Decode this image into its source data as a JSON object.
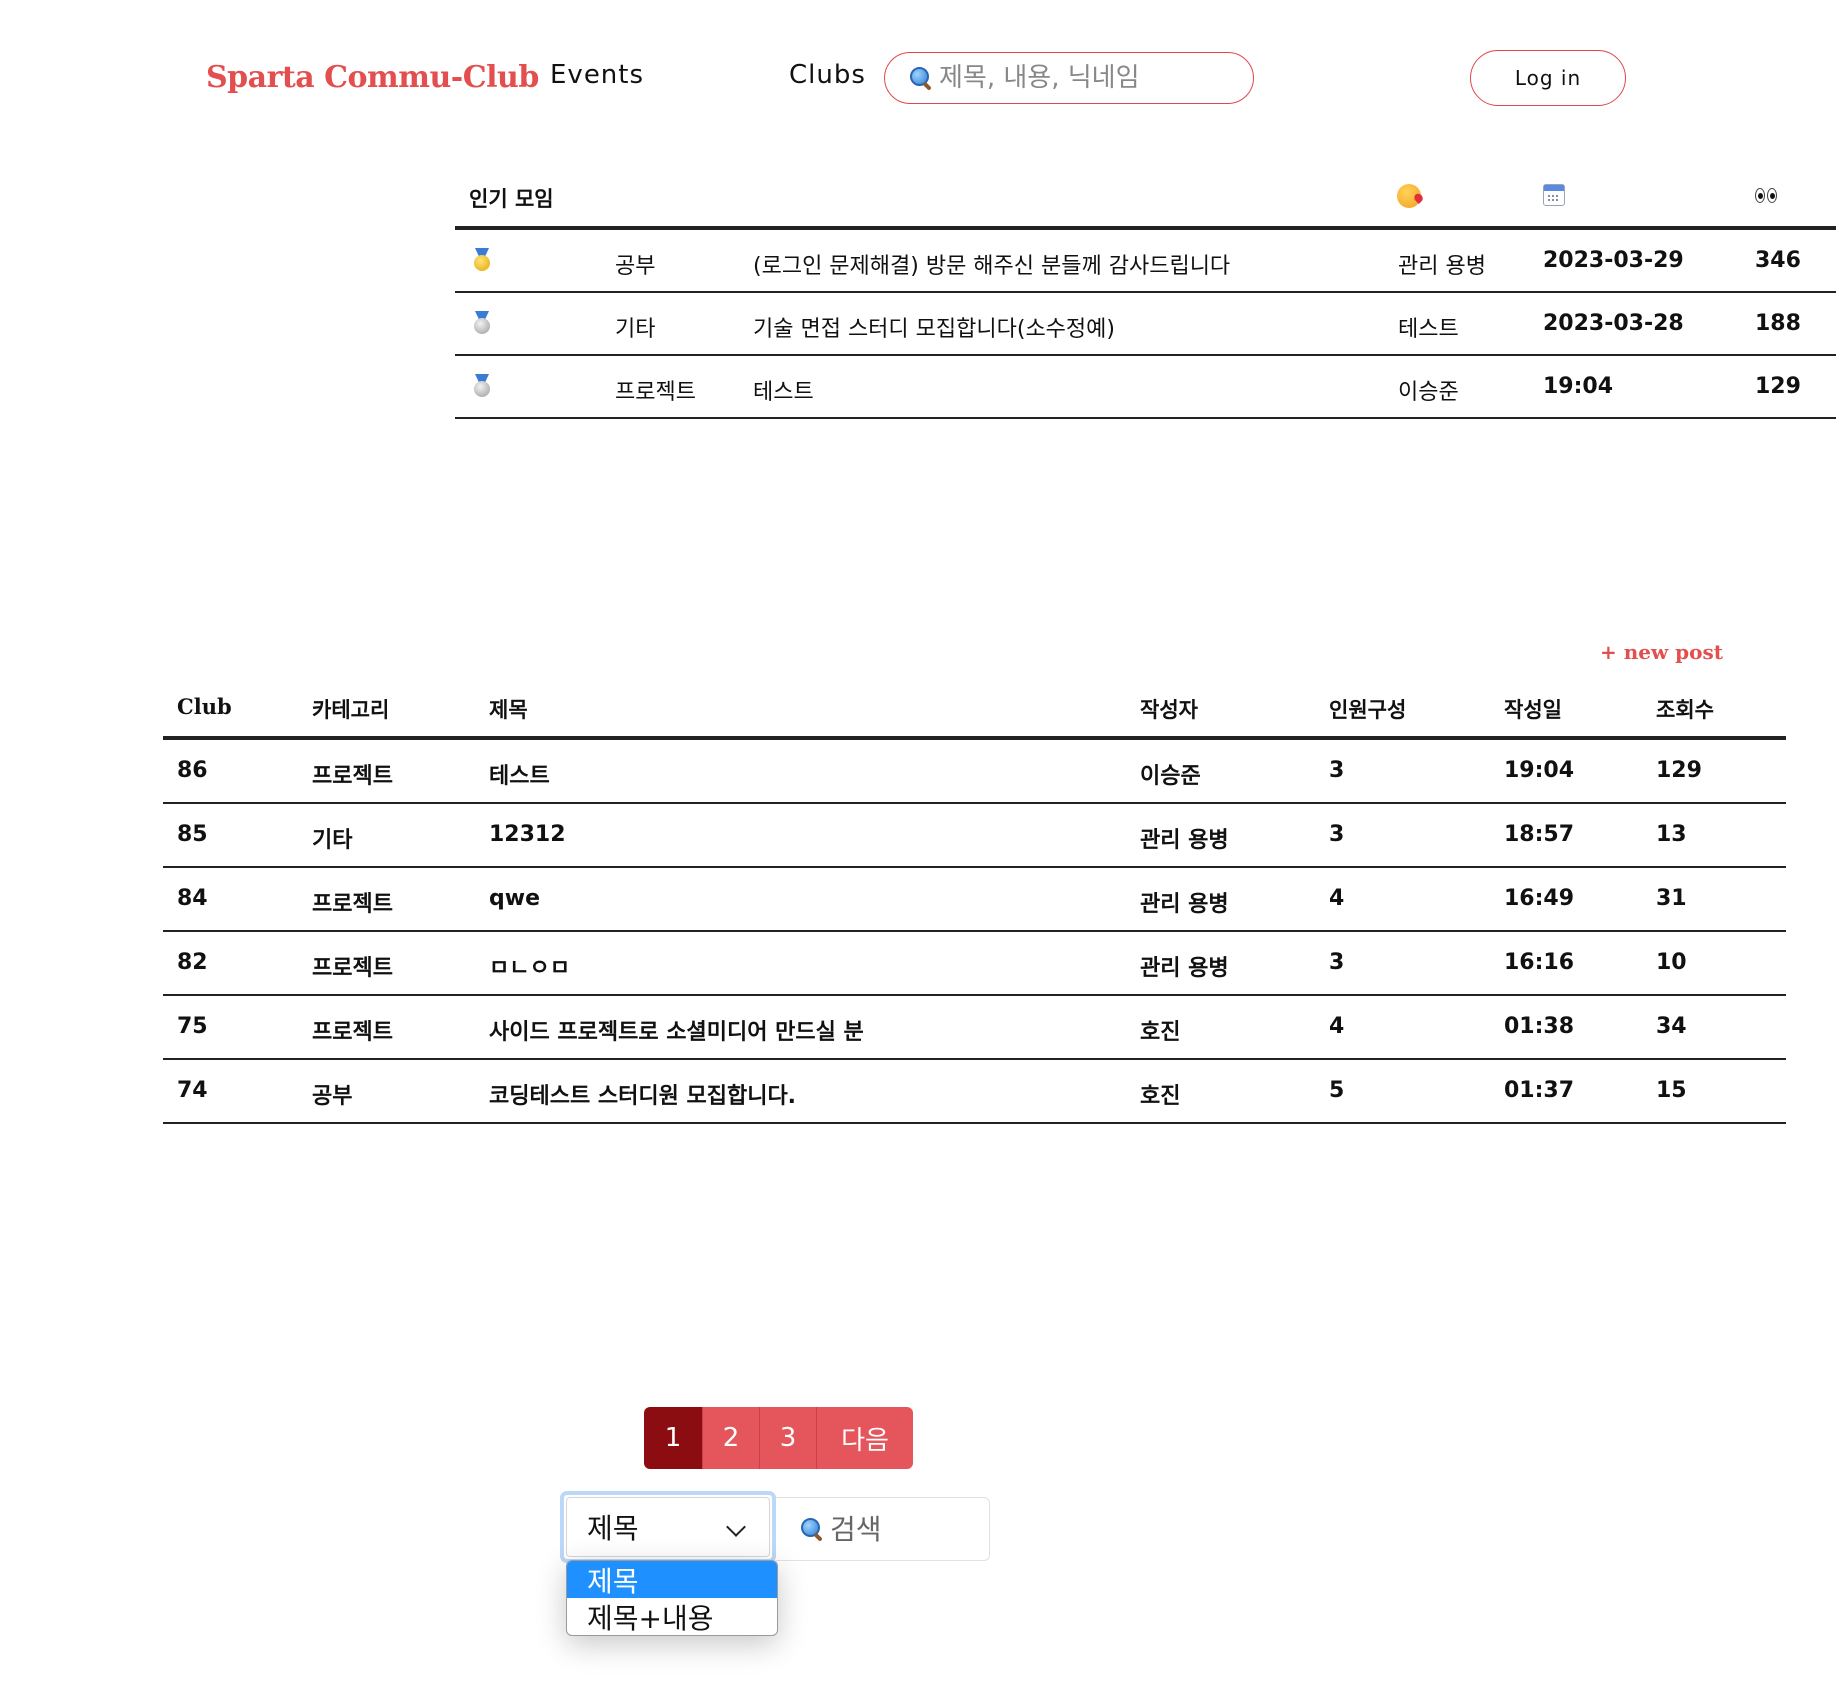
{
  "header": {
    "logo": "Sparta Commu-Club",
    "nav": [
      "Events",
      "Clubs"
    ],
    "search_placeholder": "제목, 내용, 닉네임",
    "login_label": "Log in"
  },
  "popular": {
    "title": "인기 모임",
    "header_icons": [
      "kissing-heart-icon",
      "calendar-icon",
      "eyes-icon"
    ],
    "rows": [
      {
        "medal": "gold-medal-icon",
        "category": "공부",
        "title": "(로그인 문제해결) 방문 해주신 분들께 감사드립니다",
        "author": "관리 용병",
        "date": "2023-03-29",
        "views": "346"
      },
      {
        "medal": "silver-medal-icon",
        "category": "기타",
        "title": "기술 면접 스터디 모집합니다(소수정예)",
        "author": "테스트",
        "date": "2023-03-28",
        "views": "188"
      },
      {
        "medal": "silver-medal-icon",
        "category": "프로젝트",
        "title": "테스트",
        "author": "이승준",
        "date": "19:04",
        "views": "129"
      }
    ]
  },
  "board": {
    "new_post_label": "+ new post",
    "columns": {
      "club": "Club",
      "category": "카테고리",
      "title": "제목",
      "author": "작성자",
      "members": "인원구성",
      "date": "작성일",
      "views": "조회수"
    },
    "rows": [
      {
        "club": "86",
        "category": "프로젝트",
        "title": "테스트",
        "author": "이승준",
        "members": "3",
        "date": "19:04",
        "views": "129"
      },
      {
        "club": "85",
        "category": "기타",
        "title": "12312",
        "author": "관리 용병",
        "members": "3",
        "date": "18:57",
        "views": "13"
      },
      {
        "club": "84",
        "category": "프로젝트",
        "title": "qwe",
        "author": "관리 용병",
        "members": "4",
        "date": "16:49",
        "views": "31"
      },
      {
        "club": "82",
        "category": "프로젝트",
        "title": "ㅁㄴㅇㅁ",
        "author": "관리 용병",
        "members": "3",
        "date": "16:16",
        "views": "10"
      },
      {
        "club": "75",
        "category": "프로젝트",
        "title": "사이드 프로젝트로 소셜미디어 만드실 분",
        "author": "호진",
        "members": "4",
        "date": "01:38",
        "views": "34"
      },
      {
        "club": "74",
        "category": "공부",
        "title": "코딩테스트 스터디원 모집합니다.",
        "author": "호진",
        "members": "5",
        "date": "01:37",
        "views": "15"
      }
    ]
  },
  "pagination": {
    "pages": [
      "1",
      "2",
      "3"
    ],
    "current": "1",
    "next_label": "다음"
  },
  "search_form": {
    "selected": "제목",
    "options": [
      "제목",
      "제목+내용"
    ],
    "placeholder": "검색"
  },
  "colors": {
    "accent": "#e34f4f",
    "page_active": "#8b0d12",
    "page_button": "#e5565c",
    "option_highlight": "#1e90ff"
  }
}
